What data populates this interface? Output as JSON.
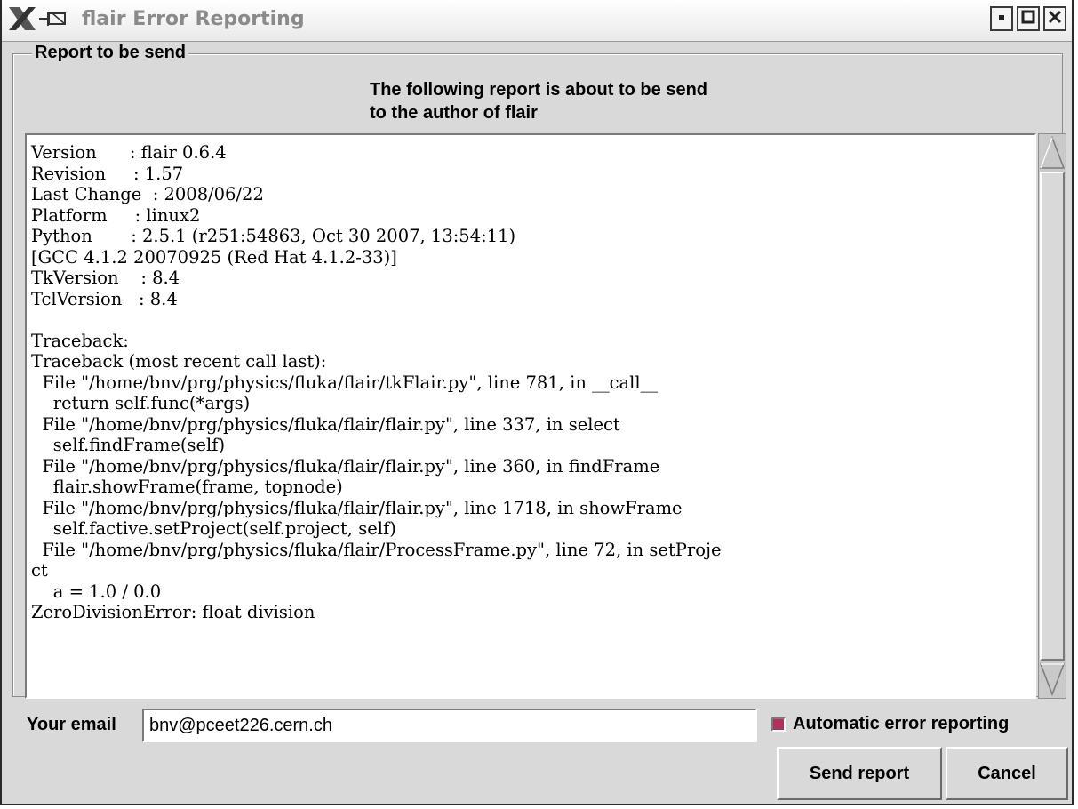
{
  "window": {
    "title": "flair Error Reporting"
  },
  "icons": {
    "app": "x-logo-icon",
    "pin": "pin-icon",
    "minimize": "minimize-icon",
    "maximize": "maximize-icon",
    "close": "close-icon"
  },
  "report_group": {
    "legend": "Report to be send",
    "message_line1": "The following report is about to be send",
    "message_line2": "to the author of flair"
  },
  "report": {
    "text": "Version      : flair 0.6.4\nRevision     : 1.57\nLast Change  : 2008/06/22\nPlatform     : linux2\nPython       : 2.5.1 (r251:54863, Oct 30 2007, 13:54:11)\n[GCC 4.1.2 20070925 (Red Hat 4.1.2-33)]\nTkVersion    : 8.4\nTclVersion   : 8.4\n\nTraceback:\nTraceback (most recent call last):\n  File \"/home/bnv/prg/physics/fluka/flair/tkFlair.py\", line 781, in __call__\n    return self.func(*args)\n  File \"/home/bnv/prg/physics/fluka/flair/flair.py\", line 337, in select\n    self.findFrame(self)\n  File \"/home/bnv/prg/physics/fluka/flair/flair.py\", line 360, in findFrame\n    flair.showFrame(frame, topnode)\n  File \"/home/bnv/prg/physics/fluka/flair/flair.py\", line 1718, in showFrame\n    self.factive.setProject(self.project, self)\n  File \"/home/bnv/prg/physics/fluka/flair/ProcessFrame.py\", line 72, in setProje\nct\n    a = 1.0 / 0.0\nZeroDivisionError: float division"
  },
  "email": {
    "label": "Your email",
    "value": "bnv@pceet226.cern.ch"
  },
  "auto_reporting": {
    "label": "Automatic error reporting",
    "checked": true
  },
  "buttons": {
    "send": "Send report",
    "cancel": "Cancel"
  },
  "colors": {
    "window_bg": "#d9d9d9",
    "checkbox_on": "#b03060"
  }
}
